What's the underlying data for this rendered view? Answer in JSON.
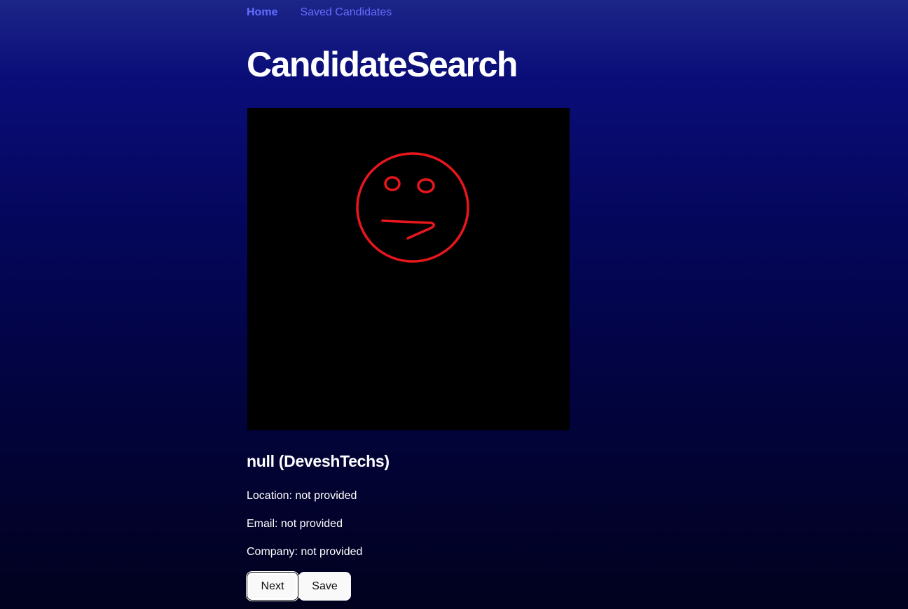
{
  "nav": {
    "home_label": "Home",
    "saved_label": "Saved Candidates"
  },
  "page": {
    "title": "CandidateSearch"
  },
  "candidate": {
    "heading": "null (DeveshTechs)",
    "location": "Location: not provided",
    "email": "Email: not provided",
    "company": "Company: not provided",
    "avatar_icon": "red-hand-drawn-face-icon",
    "avatar_color": "#e8161d"
  },
  "actions": {
    "next_label": "Next",
    "save_label": "Save"
  },
  "colors": {
    "link": "#646cff",
    "button_bg": "#f9f9f9"
  }
}
